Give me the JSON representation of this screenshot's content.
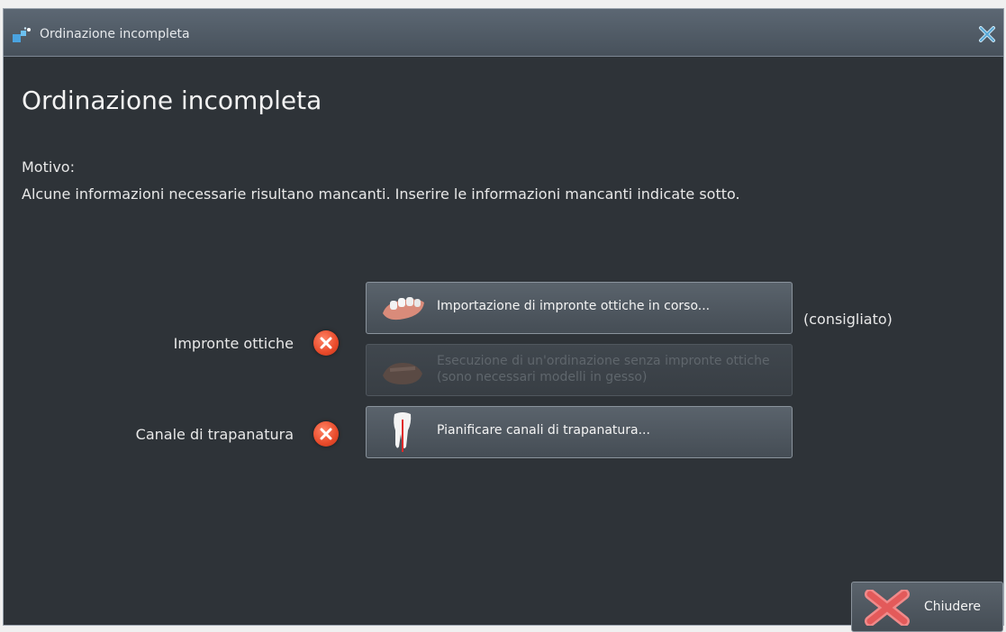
{
  "window": {
    "title": "Ordinazione incompleta",
    "app_icon": "puzzle-arrow-icon",
    "close_icon": "x-icon"
  },
  "heading": "Ordinazione incompleta",
  "reason": {
    "label": "Motivo:",
    "text": "Alcune informazioni necessarie risultano mancanti. Inserire le informazioni mancanti indicate sotto."
  },
  "items": [
    {
      "label": "Impronte ottiche",
      "status": "error",
      "actions": [
        {
          "label": "Importazione di impronte ottiche in corso...",
          "icon": "optical-impression-icon",
          "enabled": true,
          "note": "(consigliato)"
        },
        {
          "label": "Esecuzione di un'ordinazione senza impronte ottiche (sono necessari modelli in gesso)",
          "icon": "plaster-model-icon",
          "enabled": false
        }
      ]
    },
    {
      "label": "Canale di trapanatura",
      "status": "error",
      "actions": [
        {
          "label": "Pianificare canali di trapanatura...",
          "icon": "tooth-drill-icon",
          "enabled": true
        }
      ]
    }
  ],
  "footer": {
    "close_label": "Chiudere",
    "close_icon": "red-x-icon"
  },
  "colors": {
    "background": "#2e3338",
    "titlebar": "#4f5963",
    "error": "#e84a2a"
  }
}
